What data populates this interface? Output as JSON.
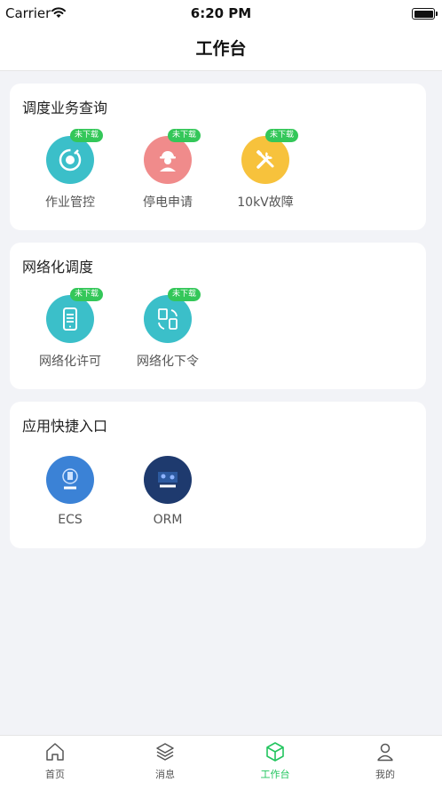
{
  "status": {
    "carrier": "Carrier",
    "time": "6:20 PM"
  },
  "nav": {
    "title": "工作台"
  },
  "sections": [
    {
      "title": "调度业务查询",
      "apps": [
        {
          "label": "作业管控",
          "badge": "未下载",
          "color": "#3bbfc9",
          "icon": "wrench-gear-icon"
        },
        {
          "label": "停电申请",
          "badge": "未下载",
          "color": "#f08b8b",
          "icon": "worker-icon"
        },
        {
          "label": "10kV故障",
          "badge": "未下载",
          "color": "#f7c23c",
          "icon": "tools-icon"
        }
      ]
    },
    {
      "title": "网络化调度",
      "apps": [
        {
          "label": "网络化许可",
          "badge": "未下载",
          "color": "#3bbfc9",
          "icon": "phone-checklist-icon"
        },
        {
          "label": "网络化下令",
          "badge": "未下载",
          "color": "#3bbfc9",
          "icon": "document-transfer-icon"
        }
      ]
    },
    {
      "title": "应用快捷入口",
      "apps": [
        {
          "label": "ECS",
          "color": "#3b82d6",
          "icon": "ecs-logo-icon"
        },
        {
          "label": "ORM",
          "color": "#1e3a6e",
          "icon": "orm-logo-icon"
        }
      ]
    }
  ],
  "tabs": [
    {
      "label": "首页",
      "icon": "home-icon",
      "active": false
    },
    {
      "label": "消息",
      "icon": "layers-icon",
      "active": false
    },
    {
      "label": "工作台",
      "icon": "cube-icon",
      "active": true
    },
    {
      "label": "我的",
      "icon": "user-icon",
      "active": false
    }
  ],
  "colors": {
    "accent": "#22c55e",
    "badge": "#34c759"
  }
}
